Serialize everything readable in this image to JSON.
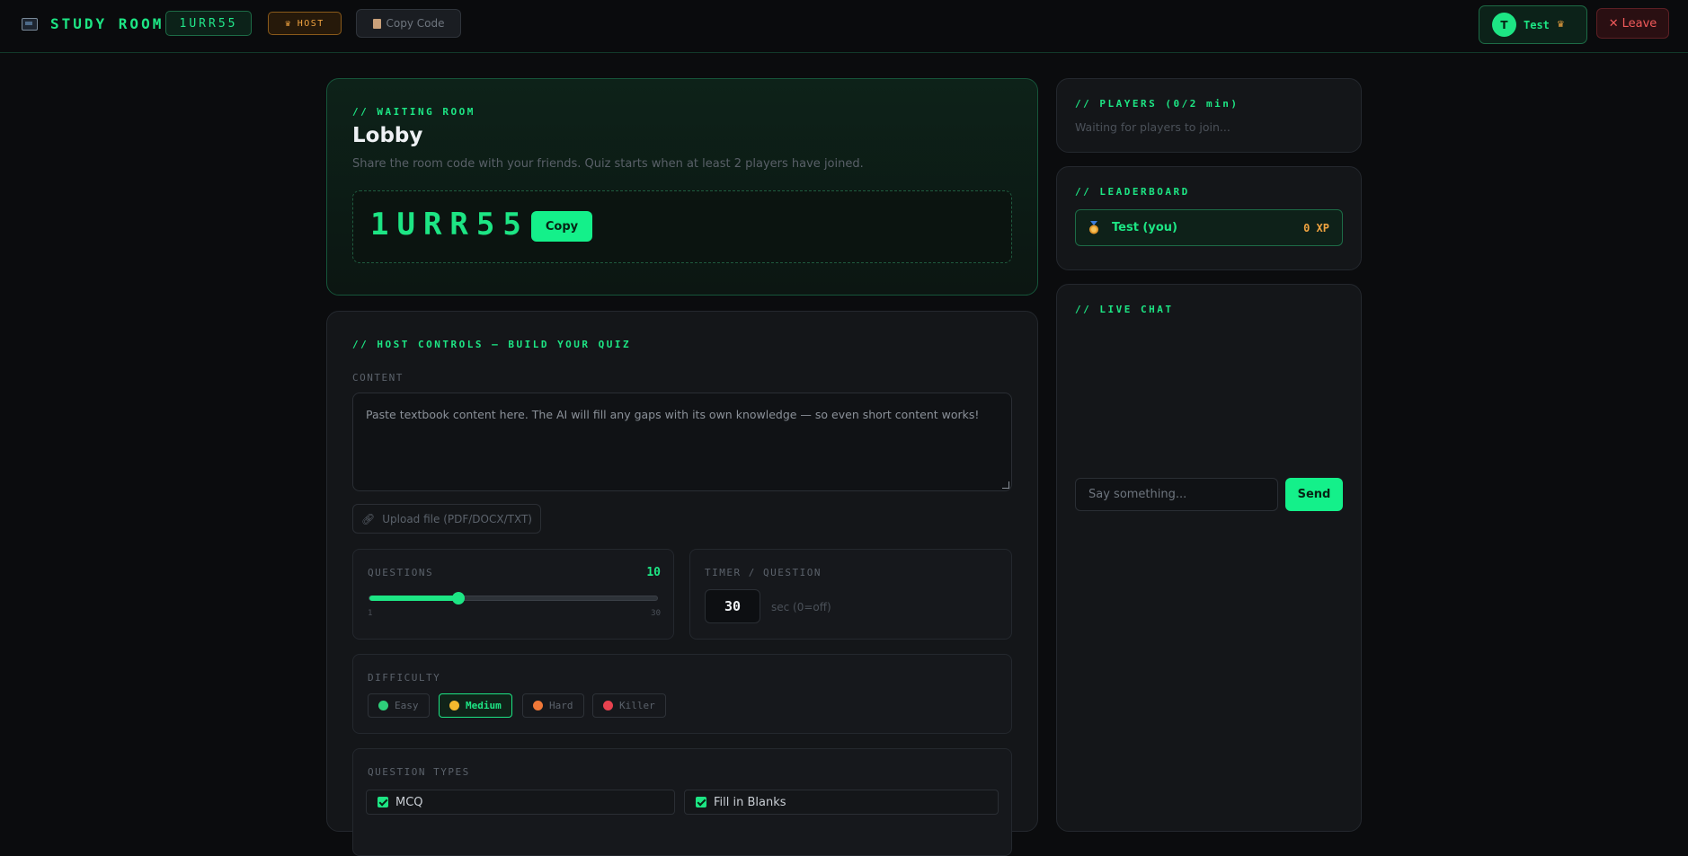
{
  "header": {
    "brand": "STUDY ROOM",
    "room_code": "1URR55",
    "host_badge": "HOST",
    "copy_code_label": "Copy Code",
    "user": {
      "initial": "T",
      "name": "Test"
    },
    "leave_label": "Leave"
  },
  "lobby": {
    "section_title": "// WAITING ROOM",
    "title": "Lobby",
    "subtitle": "Share the room code with your friends. Quiz starts when at least 2 players have joined.",
    "code": "1URR55",
    "copy_label": "Copy"
  },
  "host_controls": {
    "section_title": "// HOST CONTROLS — BUILD YOUR QUIZ",
    "content_label": "CONTENT",
    "content_placeholder": "Paste textbook content here. The AI will fill any gaps with its own knowledge — so even short content works!",
    "upload_label": "Upload file (PDF/DOCX/TXT)",
    "questions": {
      "label": "QUESTIONS",
      "value": 10,
      "min": 1,
      "max": 30,
      "min_label": "1",
      "max_label": "30",
      "value_label": "10"
    },
    "timer": {
      "label": "TIMER / QUESTION",
      "value": "30",
      "unit": "sec (0=off)"
    },
    "difficulty": {
      "label": "DIFFICULTY",
      "options": [
        {
          "label": "Easy",
          "color": "#2ecf7a",
          "active": false
        },
        {
          "label": "Medium",
          "color": "#f5b82e",
          "active": true
        },
        {
          "label": "Hard",
          "color": "#f07838",
          "active": false
        },
        {
          "label": "Killer",
          "color": "#e8424f",
          "active": false
        }
      ]
    },
    "question_types": {
      "label": "QUESTION TYPES",
      "options": [
        {
          "label": "MCQ",
          "checked": true
        },
        {
          "label": "Fill in Blanks",
          "checked": true
        }
      ]
    }
  },
  "players": {
    "section_title": "// PLAYERS (0/2 min)",
    "empty_text": "Waiting for players to join..."
  },
  "leaderboard": {
    "section_title": "// LEADERBOARD",
    "entries": [
      {
        "name": "Test (you)",
        "xp": "0 XP"
      }
    ]
  },
  "chat": {
    "section_title": "// LIVE CHAT",
    "placeholder": "Say something...",
    "send_label": "Send"
  },
  "colors": {
    "accent": "#1de584",
    "host": "#f0a340",
    "danger": "#f05a5a"
  }
}
